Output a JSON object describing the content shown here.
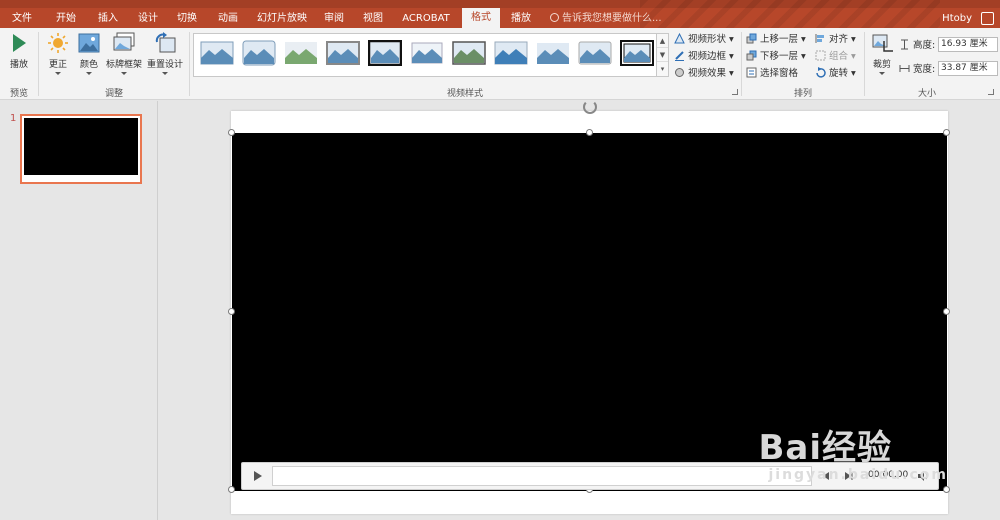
{
  "ribbon_tabs": [
    {
      "label": "文件"
    },
    {
      "label": "开始"
    },
    {
      "label": "插入"
    },
    {
      "label": "设计"
    },
    {
      "label": "切换"
    },
    {
      "label": "动画"
    },
    {
      "label": "幻灯片放映"
    },
    {
      "label": "审阅"
    },
    {
      "label": "视图"
    },
    {
      "label": "ACROBAT"
    },
    {
      "label": "格式"
    },
    {
      "label": "播放"
    }
  ],
  "active_tab": "格式",
  "tell_me_placeholder": "告诉我您想要做什么...",
  "user_name": "Htoby",
  "groups": {
    "preview": {
      "label": "预览",
      "play_label": "播放"
    },
    "adjust": {
      "label": "调整",
      "correct_label": "更正",
      "color_label": "颜色",
      "poster_label": "标牌框架",
      "reset_label": "重置设计"
    },
    "video_styles": {
      "label": "视频样式",
      "shape_label": "视频形状",
      "border_label": "视频边框",
      "effects_label": "视频效果"
    },
    "arrange": {
      "label": "排列",
      "bring_forward": "上移一层",
      "send_backward": "下移一层",
      "selection_pane": "选择窗格",
      "align": "对齐",
      "group": "组合",
      "rotate": "旋转"
    },
    "size": {
      "label": "大小",
      "crop_label": "裁剪",
      "height_label": "高度:",
      "height_value": "16.93 厘米",
      "width_label": "宽度:",
      "width_value": "33.87 厘米"
    }
  },
  "slides": [
    {
      "number": "1"
    }
  ],
  "video": {
    "time": "00:00.00"
  },
  "watermark": {
    "line1": "Bai经验",
    "line2": "jingyan.baidu.com"
  },
  "colors": {
    "accent": "#b7472a",
    "ribbon_bg": "#f3f3f3",
    "selection": "#e9764f"
  }
}
